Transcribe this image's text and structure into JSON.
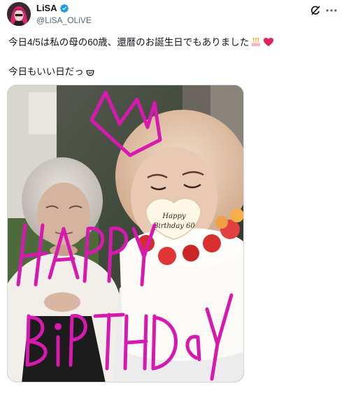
{
  "author": {
    "display_name": "LiSA",
    "handle": "@LiSA_OLiVE",
    "verified": true,
    "avatar_icon": "avatar-photo"
  },
  "actions": {
    "grok_icon": "grok-icon",
    "more_icon": "more-icon"
  },
  "post": {
    "line1": "今日4/5は私の母の60歳、還暦のお誕生日でもありました",
    "line2": "今日もいい日だっ"
  },
  "media": {
    "cake_plaque_text": "Happy Birthday 60",
    "drawn_text_line1": "HAPPY",
    "drawn_text_line2": "BiPTHDaY"
  },
  "colors": {
    "verified": "#1d9bf0",
    "heart": "#e0245e",
    "scribble": "#d61ab0",
    "handle": "#536471"
  }
}
